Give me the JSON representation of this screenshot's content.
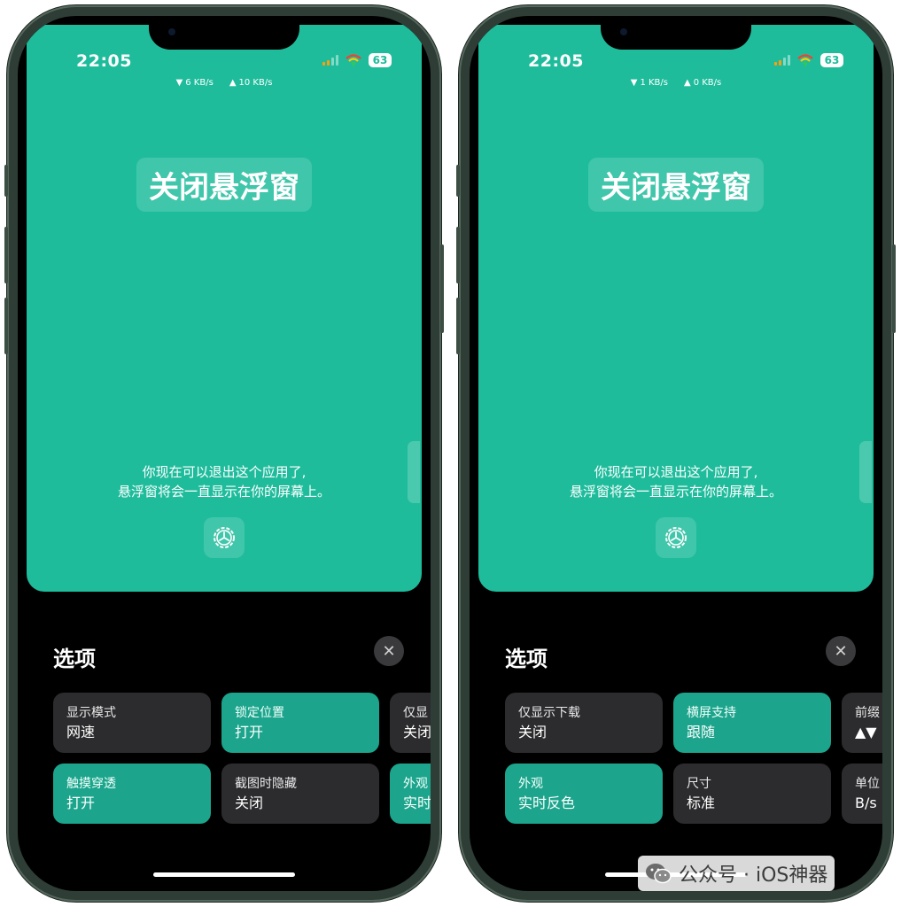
{
  "screens": [
    {
      "status": {
        "time": "22:05",
        "battery": "63",
        "download": "6 KB/s",
        "upload": "10 KB/s"
      },
      "title": "关闭悬浮窗",
      "hint_line1": "你现在可以退出这个应用了,",
      "hint_line2": "悬浮窗将会一直显示在你的屏幕上。",
      "options_title": "选项",
      "cards": [
        {
          "title": "显示模式",
          "value": "网速",
          "active": false
        },
        {
          "title": "锁定位置",
          "value": "打开",
          "active": true
        },
        {
          "title": "仅显",
          "value": "关闭",
          "active": false
        },
        {
          "title": "触摸穿透",
          "value": "打开",
          "active": true
        },
        {
          "title": "截图时隐藏",
          "value": "关闭",
          "active": false
        },
        {
          "title": "外观",
          "value": "实时",
          "active": true
        }
      ]
    },
    {
      "status": {
        "time": "22:05",
        "battery": "63",
        "download": "1 KB/s",
        "upload": "0 KB/s"
      },
      "title": "关闭悬浮窗",
      "hint_line1": "你现在可以退出这个应用了,",
      "hint_line2": "悬浮窗将会一直显示在你的屏幕上。",
      "options_title": "选项",
      "cards": [
        {
          "title": "仅显示下载",
          "value": "关闭",
          "active": false
        },
        {
          "title": "横屏支持",
          "value": "跟随",
          "active": true
        },
        {
          "title": "前缀",
          "value": "▲▼",
          "active": false
        },
        {
          "title": "外观",
          "value": "实时反色",
          "active": true
        },
        {
          "title": "尺寸",
          "value": "标准",
          "active": false
        },
        {
          "title": "单位",
          "value": "B/s",
          "active": false
        }
      ]
    }
  ],
  "colors": {
    "accent": "#1fbc9c",
    "card_active": "#1ca58c",
    "card": "#2c2c2e",
    "close_button": "#3a3a3c"
  },
  "icons": {
    "settings": "gear-icon",
    "close": "close-icon"
  },
  "watermark": {
    "text": "公众号 · iOS神器"
  }
}
